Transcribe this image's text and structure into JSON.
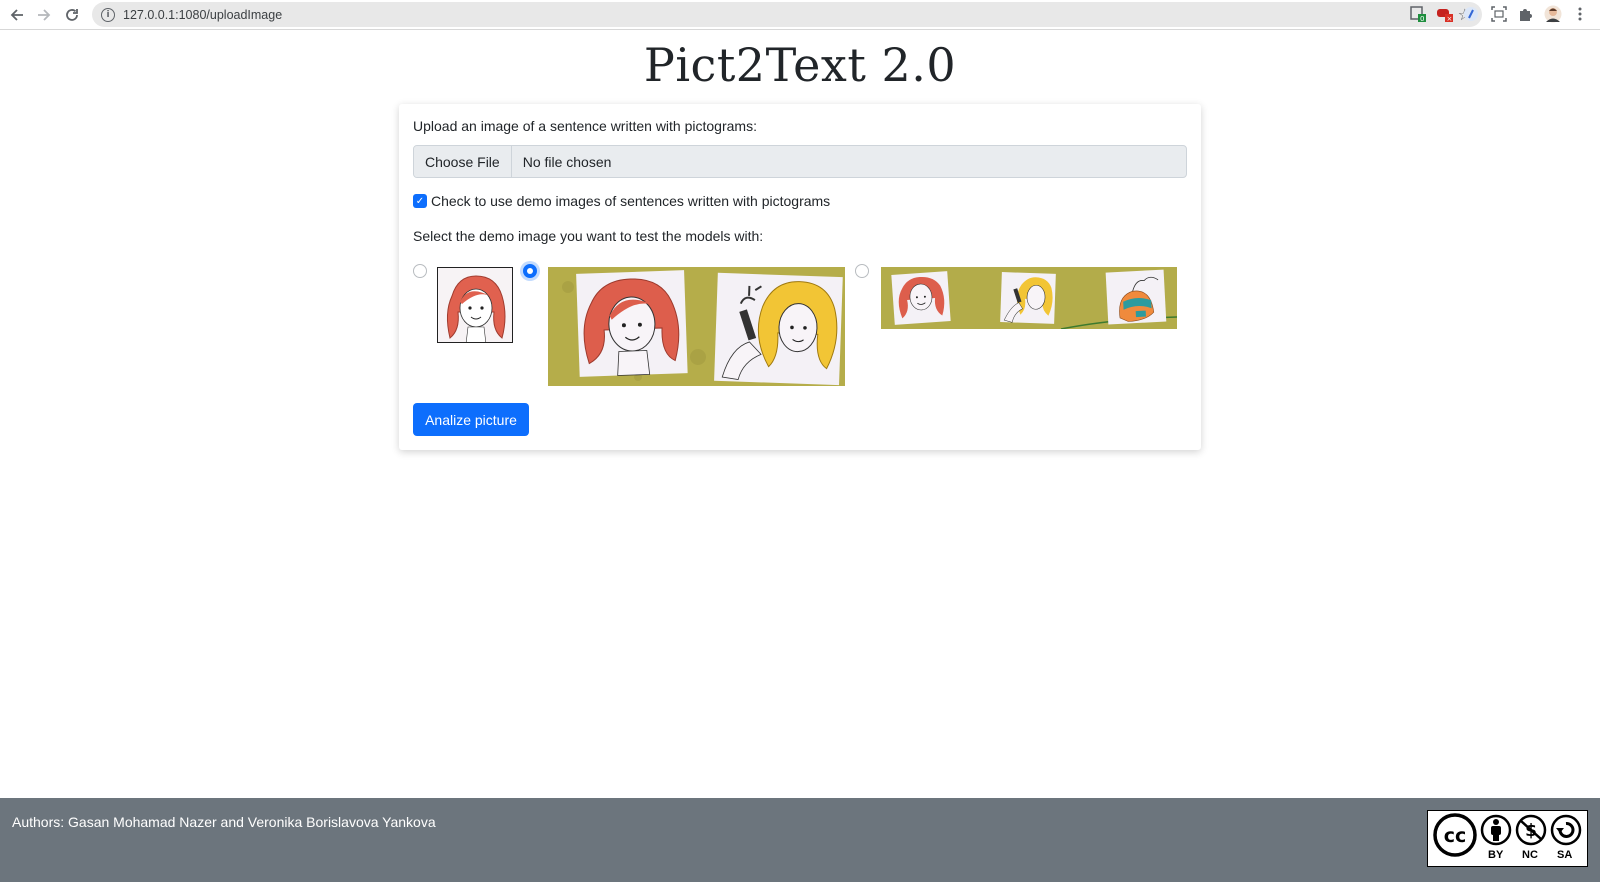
{
  "browser": {
    "url": "127.0.0.1:1080/uploadImage",
    "back_icon": "arrow-left-icon",
    "forward_icon": "arrow-right-icon",
    "reload_icon": "reload-icon"
  },
  "page": {
    "title": "Pict2Text 2.0"
  },
  "form": {
    "upload_label": "Upload an image of a sentence written with pictograms:",
    "file_button": "Choose File",
    "file_status": "No file chosen",
    "demo_checkbox_label": "Check to use demo images of sentences written with pictograms",
    "demo_checkbox_checked": true,
    "select_label": "Select the demo image you want to test the models with:",
    "demo_options": [
      {
        "id": "demo-1",
        "selected": false,
        "content": "girl pictogram"
      },
      {
        "id": "demo-2",
        "selected": true,
        "content": "girl and brushing hair pictograms"
      },
      {
        "id": "demo-3",
        "selected": false,
        "content": "girl, brushing hair and backpack pictograms"
      }
    ],
    "submit_label": "Analize picture"
  },
  "footer": {
    "authors": "Authors: Gasan Mohamad Nazer and Veronika Borislavova Yankova",
    "license_labels": [
      "BY",
      "NC",
      "SA"
    ]
  },
  "colors": {
    "primary": "#0d6efd",
    "footer_bg": "#6c757d",
    "demo_bg": "#b5ad4a"
  }
}
